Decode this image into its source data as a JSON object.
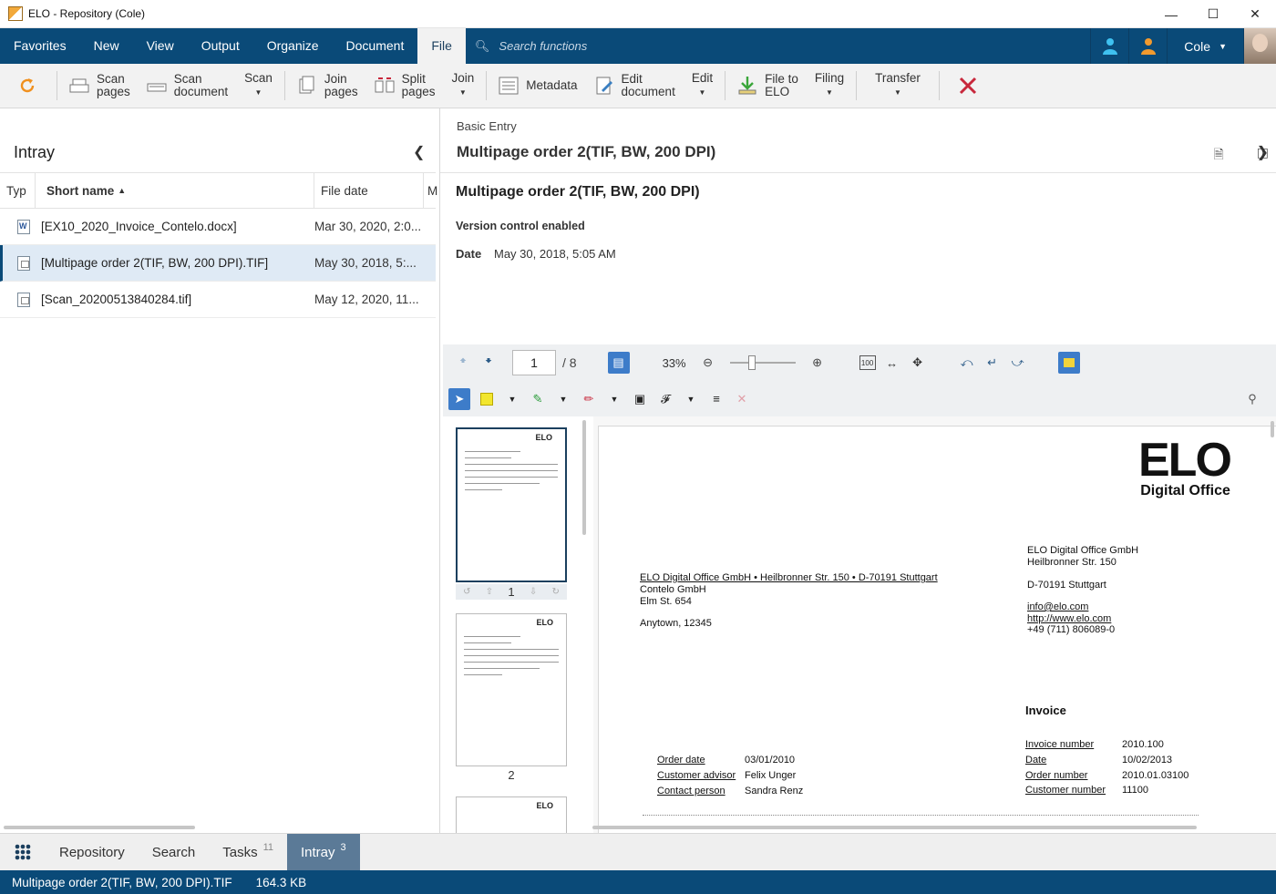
{
  "window": {
    "title": "ELO - Repository (Cole)"
  },
  "menubar": {
    "items": [
      "Favorites",
      "New",
      "View",
      "Output",
      "Organize",
      "Document",
      "File"
    ],
    "active": "File",
    "search_placeholder": "Search functions",
    "user": "Cole"
  },
  "ribbon": {
    "refresh": "",
    "scan_pages": "Scan\npages",
    "scan_document": "Scan\ndocument",
    "scan": "Scan",
    "join_pages": "Join\npages",
    "split_pages": "Split\npages",
    "join": "Join",
    "metadata": "Metadata",
    "edit_document": "Edit\ndocument",
    "edit": "Edit",
    "file_to_elo": "File to\nELO",
    "filing": "Filing",
    "transfer": "Transfer"
  },
  "intray": {
    "title": "Intray",
    "columns": {
      "type": "Typ",
      "short_name": "Short name",
      "file_date": "File date",
      "extra": "M"
    },
    "rows": [
      {
        "name": "[EX10_2020_Invoice_Contelo.docx]",
        "date": "Mar 30, 2020, 2:0...",
        "kind": "doc"
      },
      {
        "name": "[Multipage order 2(TIF, BW, 200 DPI).TIF]",
        "date": "May 30, 2018, 5:...",
        "kind": "tif"
      },
      {
        "name": "[Scan_20200513840284.tif]",
        "date": "May 12, 2020, 11...",
        "kind": "tif"
      }
    ]
  },
  "detail": {
    "breadcrumb": "Basic Entry",
    "title": "Multipage order 2(TIF, BW, 200 DPI)",
    "meta_title": "Multipage order 2(TIF, BW, 200 DPI)",
    "version_control": "Version control enabled",
    "date_label": "Date",
    "date_value": "May 30, 2018, 5:05 AM"
  },
  "viewer": {
    "page": "1",
    "page_total": "/ 8",
    "zoom": "33%",
    "fit_label": "100",
    "thumbnails": [
      "1",
      "2"
    ]
  },
  "document": {
    "logo_text": "ELO",
    "logo_sub": "Digital Office",
    "sender": [
      "ELO Digital Office GmbH",
      "Heilbronner Str. 150",
      "",
      "D-70191 Stuttgart"
    ],
    "return_line": "ELO Digital Office GmbH • Heilbronner Str. 150 • D-70191 Stuttgart",
    "recipient": [
      "Contelo GmbH",
      "Elm St. 654"
    ],
    "recipient_city": "Anytown, 12345",
    "contact": [
      "info@elo.com",
      "http://www.elo.com",
      "+49 (711) 806089-0"
    ],
    "invoice_title": "Invoice",
    "order_fields": [
      {
        "k": "Order date",
        "v": "03/01/2010"
      },
      {
        "k": "Customer advisor",
        "v": "Felix Unger"
      },
      {
        "k": "Contact person",
        "v": "Sandra Renz"
      }
    ],
    "invoice_fields": [
      {
        "k": "Invoice number",
        "v": "2010.100"
      },
      {
        "k": "Date",
        "v": "10/02/2013"
      },
      {
        "k": "Order number",
        "v": "2010.01.03100"
      },
      {
        "k": "Customer number",
        "v": "11100"
      }
    ]
  },
  "bottom_tabs": [
    {
      "label": "Repository",
      "count": ""
    },
    {
      "label": "Search",
      "count": ""
    },
    {
      "label": "Tasks",
      "count": "11"
    },
    {
      "label": "Intray",
      "count": "3"
    }
  ],
  "status": {
    "filename": "Multipage order 2(TIF, BW, 200 DPI).TIF",
    "size": "164.3 KB"
  },
  "colors": {
    "brand_blue": "#0a4a78",
    "selection": "#dfeaf5",
    "active_tab": "#5b7a97",
    "cancel_red": "#c8283c"
  }
}
